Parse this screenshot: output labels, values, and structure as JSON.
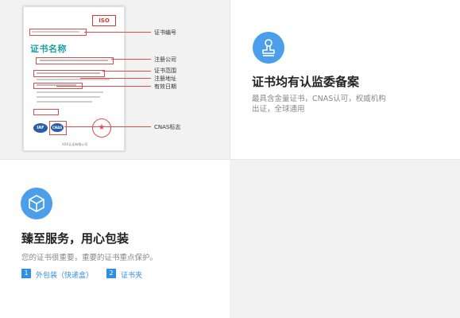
{
  "certificate": {
    "stamp_text": "ISO",
    "title": "证书名称",
    "footer": "XXX认证有限公司",
    "callouts": [
      "证书编号",
      "注册公司",
      "证书范围",
      "注册地址",
      "有效日期",
      "CNAS标志"
    ],
    "badges": [
      "IAF",
      "CNAS"
    ]
  },
  "feature_record": {
    "icon": "stamp-icon",
    "title": "证书均有认监委备案",
    "desc_line1": "最具含金量证书，CNAS认可，权威机构",
    "desc_line2": "出证，全球通用"
  },
  "feature_service": {
    "icon": "box-icon",
    "title": "臻至服务，用心包装",
    "desc": "您的证书很重要，重要的证书重点保护。",
    "options": [
      {
        "num": "1",
        "label": "外包装（快递盒）"
      },
      {
        "num": "2",
        "label": "证书夹"
      }
    ]
  },
  "colors": {
    "accent": "#4a9eea",
    "link": "#2f8fe0",
    "callout": "#e04b4b",
    "title_teal": "#1aa0a4"
  }
}
